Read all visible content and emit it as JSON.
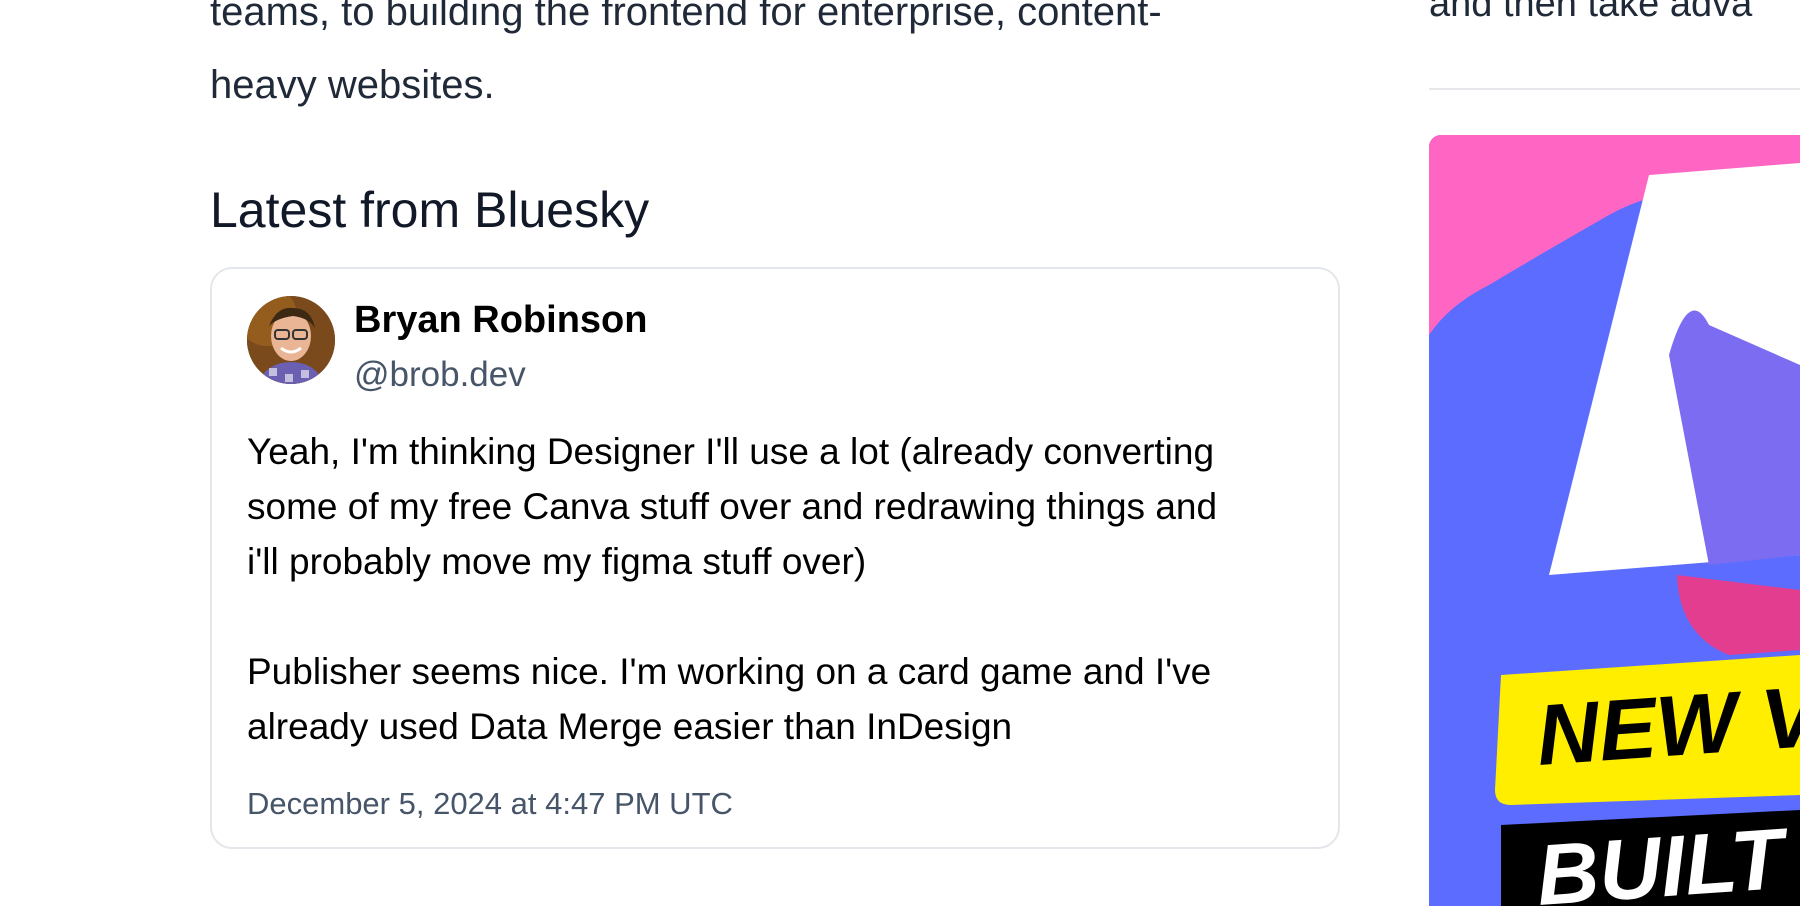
{
  "intro": {
    "line1": "teams, to building the frontend for enterprise, content-",
    "line2": "heavy websites."
  },
  "bluesky": {
    "section_title": "Latest from Bluesky",
    "post": {
      "author_name": "Bryan Robinson",
      "author_handle": "@brob.dev",
      "body_lines": [
        "Yeah, I'm thinking Designer I'll use a lot (already converting",
        "some of my free Canva stuff over and redrawing things and",
        "i'll probably move my figma stuff over)",
        "",
        "Publisher seems nice. I'm working on a card game and I've",
        "already used Data Merge easier than InDesign"
      ],
      "timestamp": "December 5, 2024 at 4:47 PM UTC"
    }
  },
  "sidebar": {
    "partial_text": "and then take adva",
    "promo": {
      "banner_line1": "NEW V",
      "banner_line2": "BUILT",
      "colors": {
        "pink": "#ff66c4",
        "blue": "#5b6cff",
        "yellow": "#ffee00",
        "black": "#000000"
      }
    }
  }
}
